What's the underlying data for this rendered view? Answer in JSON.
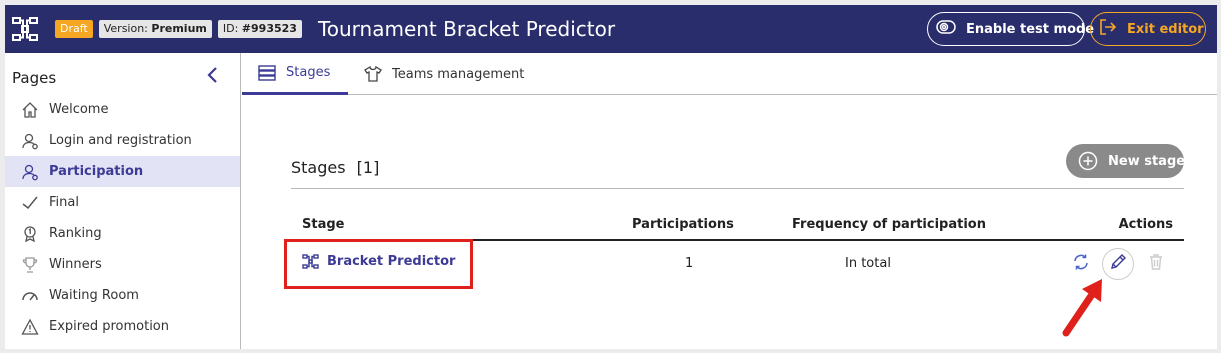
{
  "header": {
    "badges": {
      "draft": "Draft",
      "version_label": "Version:",
      "version_value": "Premium",
      "id_label": "ID:",
      "id_value": "#993523"
    },
    "title": "Tournament Bracket Predictor",
    "test_mode_label": "Enable test mode",
    "exit_label": "Exit editor",
    "colors": {
      "bar": "#2a2d6b",
      "draft": "#f5a623",
      "exit": "#f5a623"
    }
  },
  "sidebar": {
    "title": "Pages",
    "items": [
      {
        "label": "Welcome",
        "icon": "home-icon"
      },
      {
        "label": "Login and registration",
        "icon": "user-login-icon"
      },
      {
        "label": "Participation",
        "icon": "user-participation-icon",
        "active": true
      },
      {
        "label": "Final",
        "icon": "check-icon"
      },
      {
        "label": "Ranking",
        "icon": "medal-icon"
      },
      {
        "label": "Winners",
        "icon": "trophy-icon"
      },
      {
        "label": "Waiting Room",
        "icon": "gauge-icon"
      },
      {
        "label": "Expired promotion",
        "icon": "warning-icon"
      }
    ]
  },
  "tabs": [
    {
      "label": "Stages",
      "icon": "stack-icon",
      "active": true
    },
    {
      "label": "Teams management",
      "icon": "tshirt-icon"
    }
  ],
  "stages": {
    "title": "Stages",
    "count": "[1]",
    "new_stage_label": "New stage",
    "columns": {
      "stage": "Stage",
      "participations": "Participations",
      "frequency": "Frequency of participation",
      "actions": "Actions"
    },
    "rows": [
      {
        "stage": "Bracket Predictor",
        "participations": "1",
        "frequency": "In total"
      }
    ]
  },
  "annotation_color": "#e0201b"
}
